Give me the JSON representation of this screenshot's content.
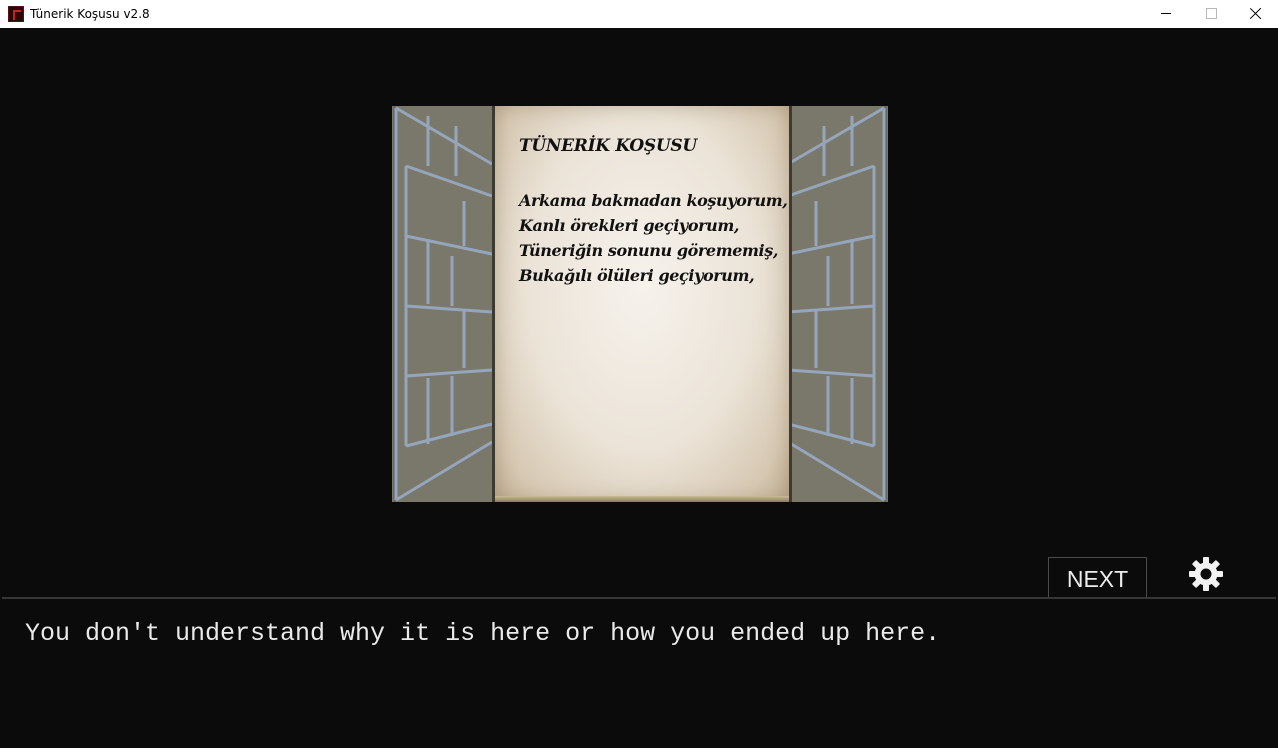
{
  "window": {
    "title": "Tünerik Koşusu v2.8",
    "icon": "game-logo-icon",
    "controls": [
      "minimize-icon",
      "maximize-icon",
      "close-icon"
    ]
  },
  "scene": {
    "description_icon": "brick-corridor",
    "note": {
      "title": "TÜNERİK KOŞUSU",
      "lines": [
        "Arkama bakmadan koşuyorum,",
        "Kanlı örekleri geçiyorum,",
        "Tüneriğin sonunu görememiş,",
        "Bukağılı ölüleri geçiyorum,"
      ]
    }
  },
  "controls": {
    "next_label": "NEXT",
    "settings_icon": "gear-icon"
  },
  "dialog": {
    "text": "You don't understand why it is here or how you ended up here."
  },
  "colors": {
    "background": "#0b0b0b",
    "text": "#eaeaea",
    "wall": "#7a786a",
    "mortar": "#95a6bc",
    "paper": "#efe8de"
  }
}
